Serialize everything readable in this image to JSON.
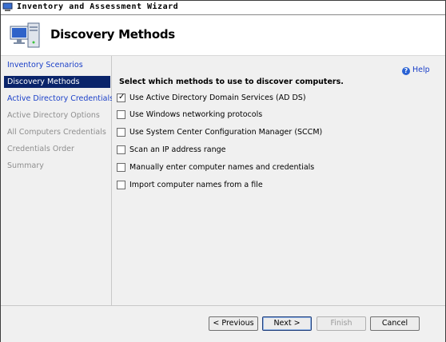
{
  "window": {
    "title": "Inventory and Assessment Wizard"
  },
  "header": {
    "title": "Discovery Methods",
    "icon": "computer-network-icon"
  },
  "sidebar": {
    "items": [
      {
        "label": "Inventory Scenarios",
        "state": "link"
      },
      {
        "label": "Discovery Methods",
        "state": "active"
      },
      {
        "label": "Active Directory Credentials",
        "state": "link"
      },
      {
        "label": "Active Directory Options",
        "state": "disabled"
      },
      {
        "label": "All Computers Credentials",
        "state": "disabled"
      },
      {
        "label": "Credentials Order",
        "state": "disabled"
      },
      {
        "label": "Summary",
        "state": "disabled"
      }
    ]
  },
  "main": {
    "help_label": "Help",
    "prompt": "Select which methods to use to discover computers.",
    "options": [
      {
        "label": "Use Active Directory Domain Services (AD DS)",
        "checked": true
      },
      {
        "label": "Use Windows networking protocols",
        "checked": false
      },
      {
        "label": "Use System Center Configuration Manager (SCCM)",
        "checked": false
      },
      {
        "label": "Scan an IP address range",
        "checked": false
      },
      {
        "label": "Manually enter computer names and credentials",
        "checked": false
      },
      {
        "label": "Import computer names from a file",
        "checked": false
      }
    ]
  },
  "footer": {
    "previous_label": "< Previous",
    "next_label": "Next >",
    "finish_label": "Finish",
    "cancel_label": "Cancel"
  },
  "colors": {
    "link": "#1a3fc8",
    "active_bg": "#0a246a",
    "disabled_text": "#8f8f8f"
  }
}
